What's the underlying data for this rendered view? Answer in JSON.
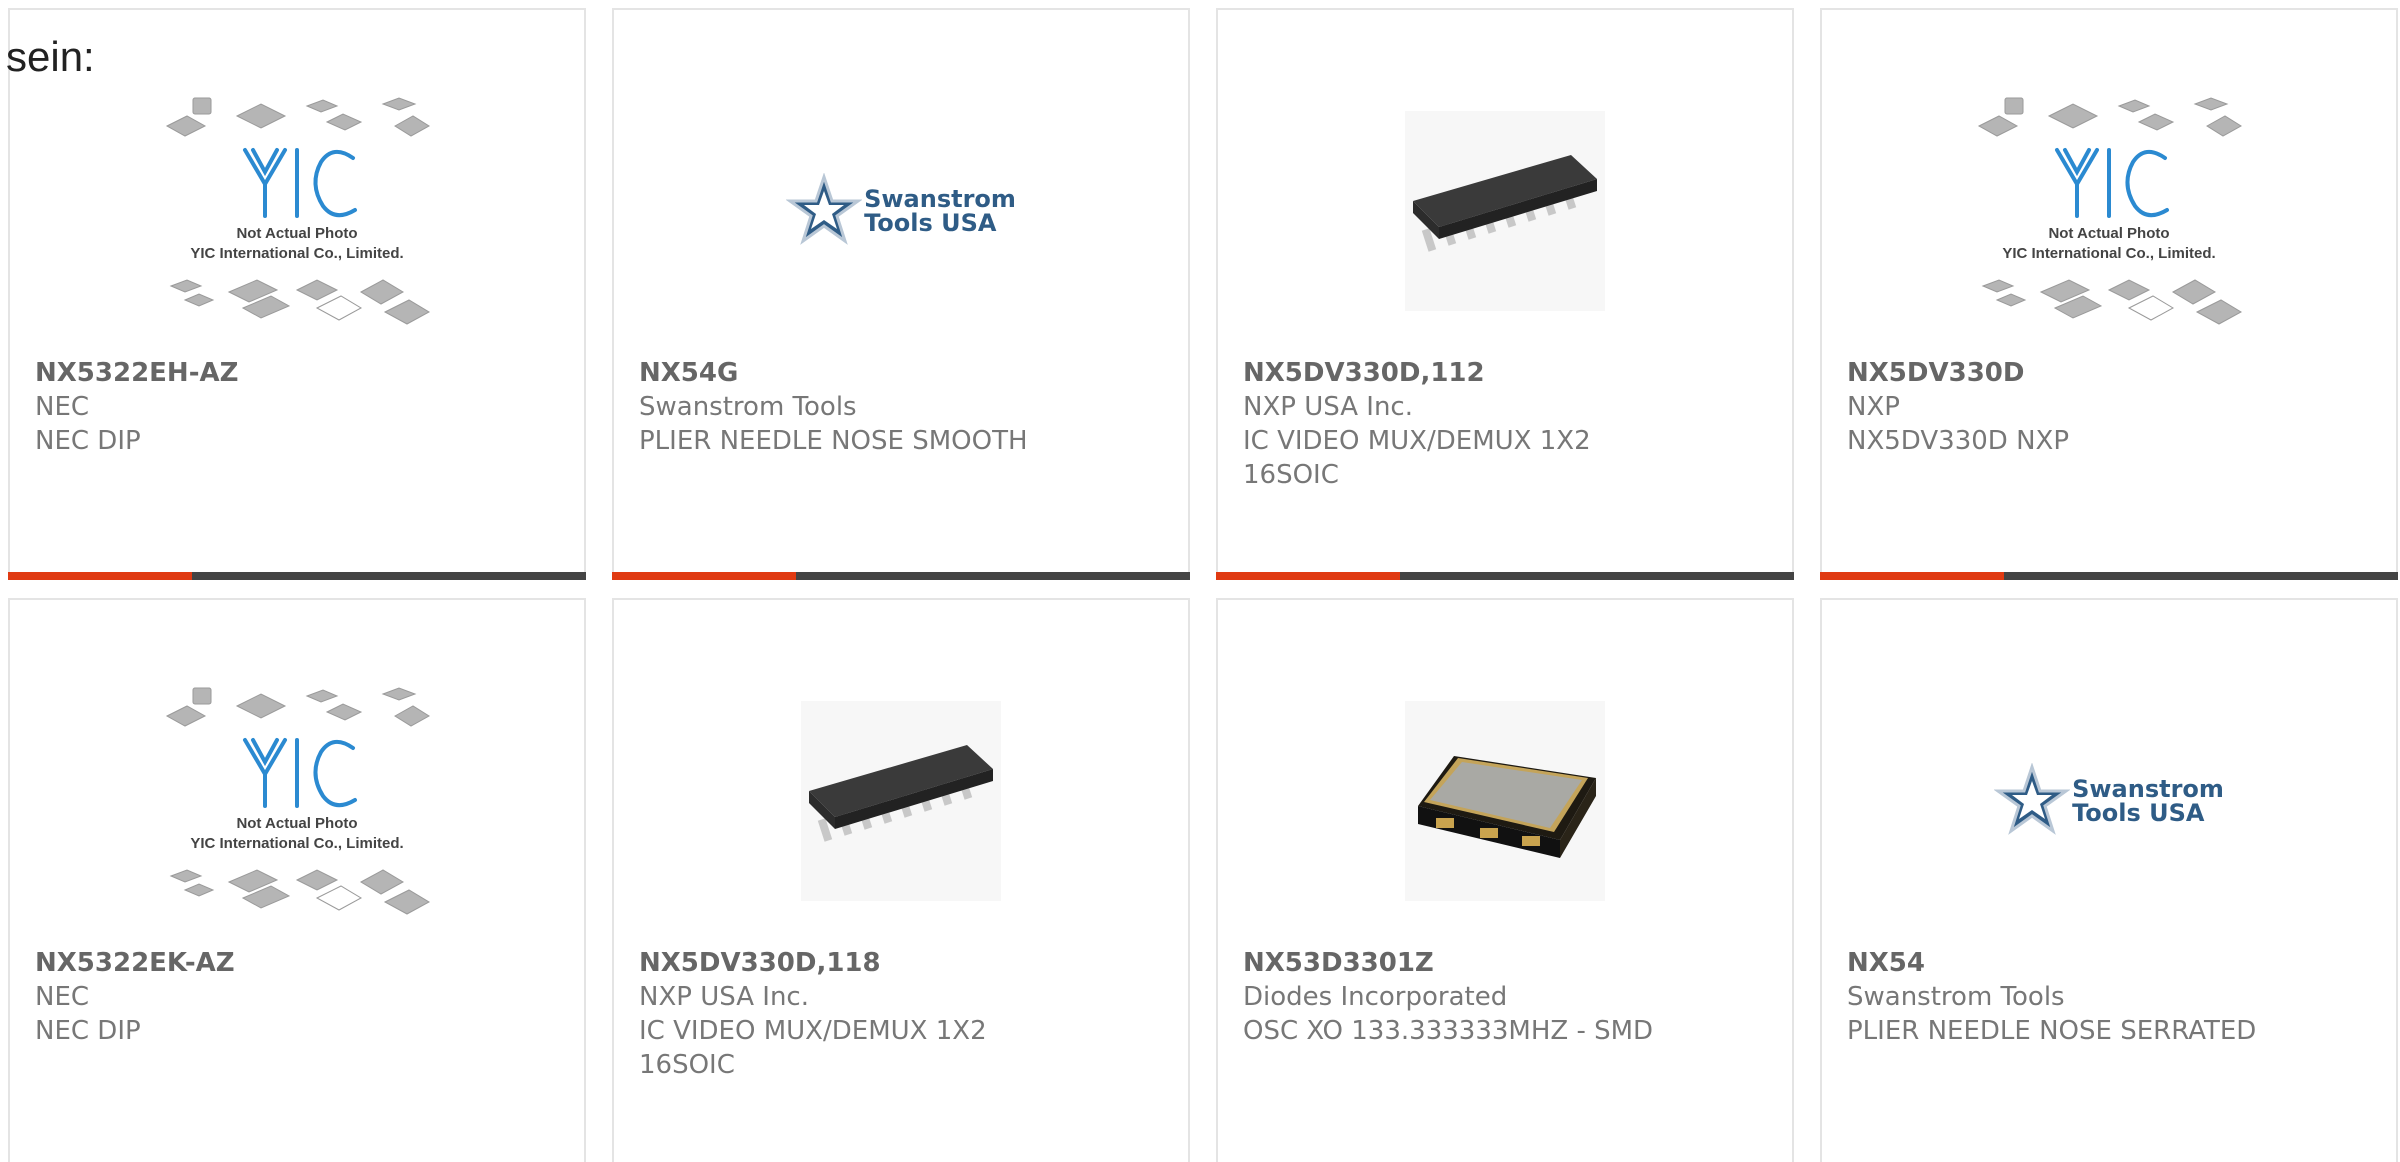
{
  "intro_text": "sein:",
  "placeholder": {
    "line1": "Not Actual Photo",
    "line2": "YIC International Co., Limited.",
    "logo": "YIC"
  },
  "swanstrom_logo": {
    "line1": "Swanstrom",
    "line2": "Tools USA"
  },
  "products": [
    {
      "part": "NX5322EH-AZ",
      "maker": "NEC",
      "desc": "NEC DIP",
      "image": "yic-placeholder"
    },
    {
      "part": "NX54G",
      "maker": "Swanstrom Tools",
      "desc": "PLIER NEEDLE NOSE SMOOTH",
      "image": "swanstrom-logo"
    },
    {
      "part": "NX5DV330D,112",
      "maker": "NXP USA Inc.",
      "desc": "IC VIDEO MUX/DEMUX 1X2 16SOIC",
      "image": "soic-chip"
    },
    {
      "part": "NX5DV330D",
      "maker": "NXP",
      "desc": "NX5DV330D NXP",
      "image": "yic-placeholder"
    },
    {
      "part": "NX5322EK-AZ",
      "maker": "NEC",
      "desc": "NEC DIP",
      "image": "yic-placeholder"
    },
    {
      "part": "NX5DV330D,118",
      "maker": "NXP USA Inc.",
      "desc": "IC VIDEO MUX/DEMUX 1X2 16SOIC",
      "image": "soic-chip"
    },
    {
      "part": "NX53D3301Z",
      "maker": "Diodes Incorporated",
      "desc": "OSC XO 133.333333MHZ - SMD",
      "image": "oscillator"
    },
    {
      "part": "NX54",
      "maker": "Swanstrom Tools",
      "desc": "PLIER NEEDLE NOSE SERRATED",
      "image": "swanstrom-logo"
    }
  ],
  "colors": {
    "accent": "#e03a12",
    "bar": "#444444",
    "border": "#e4e4e4",
    "text": "#777777"
  }
}
